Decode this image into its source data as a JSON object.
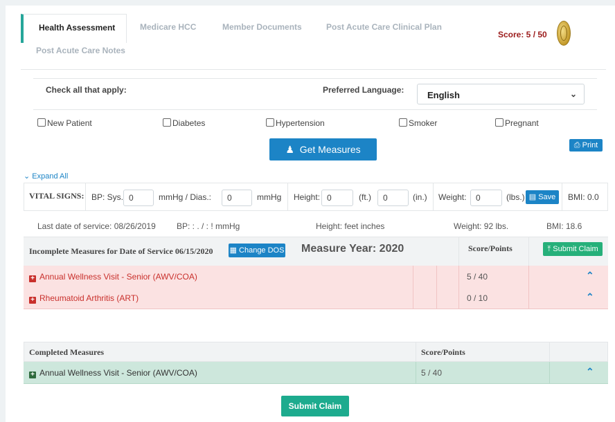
{
  "tabs": [
    {
      "label": "Health Assessment",
      "active": true
    },
    {
      "label": "Medicare HCC",
      "active": false
    },
    {
      "label": "Member Documents",
      "active": false
    },
    {
      "label": "Post Acute Care Clinical Plan",
      "active": false
    },
    {
      "label": "Post Acute Care Notes",
      "active": false
    }
  ],
  "score": {
    "text": "Score:  5 / 50",
    "color": "#9b1b1b"
  },
  "filters": {
    "check_all_label": "Check all that apply:",
    "preferred_language_label": "Preferred Language:",
    "language_selected": "English",
    "checkboxes": [
      {
        "label": "New Patient",
        "checked": false
      },
      {
        "label": "Diabetes",
        "checked": false
      },
      {
        "label": "Hypertension",
        "checked": false
      },
      {
        "label": "Smoker",
        "checked": false
      },
      {
        "label": "Pregnant",
        "checked": false
      }
    ]
  },
  "actions": {
    "get_measures": "Get Measures",
    "print": "Print",
    "expand_all": "Expand All"
  },
  "vitals": {
    "title": "VITAL SIGNS:",
    "bp_sys_label": "BP: Sys.",
    "bp_sys_value": "0",
    "mmhg_dias_label": "mmHg  /  Dias.:",
    "bp_dias_value": "0",
    "mmhg_label": "mmHg",
    "height_label": "Height:",
    "height_ft_value": "0",
    "ft_label": "(ft.)",
    "height_in_value": "0",
    "in_label": "(in.)",
    "weight_label": "Weight:",
    "weight_value": "0",
    "lbs_label": "(lbs.)",
    "save_label": "Save",
    "bmi_text": "BMI:  0.0"
  },
  "last_service": {
    "date_text": "Last date of service: 08/26/2019",
    "bp_text": "BP:  :  . / :  ! mmHg",
    "height_text": "Height:   feet      inches",
    "weight_text": "Weight: 92  lbs.",
    "bmi_text": "BMI: 18.6"
  },
  "incomplete": {
    "title": "Incomplete Measures for Date of Service 06/15/2020",
    "change_dos": "Change DOS",
    "measure_year": "Measure Year: 2020",
    "score_points_header": "Score/Points",
    "submit_claim": "Submit Claim",
    "rows": [
      {
        "name": "Annual Wellness Visit - Senior (AWV/COA)",
        "points": "5 / 40"
      },
      {
        "name": "Rheumatoid Arthritis (ART)",
        "points": "0 / 10"
      }
    ]
  },
  "completed": {
    "title": "Completed Measures",
    "score_points_header": "Score/Points",
    "rows": [
      {
        "name": "Annual Wellness Visit - Senior (AWV/COA)",
        "points": "5  / 40"
      }
    ]
  },
  "footer": {
    "submit_claim": "Submit Claim"
  }
}
